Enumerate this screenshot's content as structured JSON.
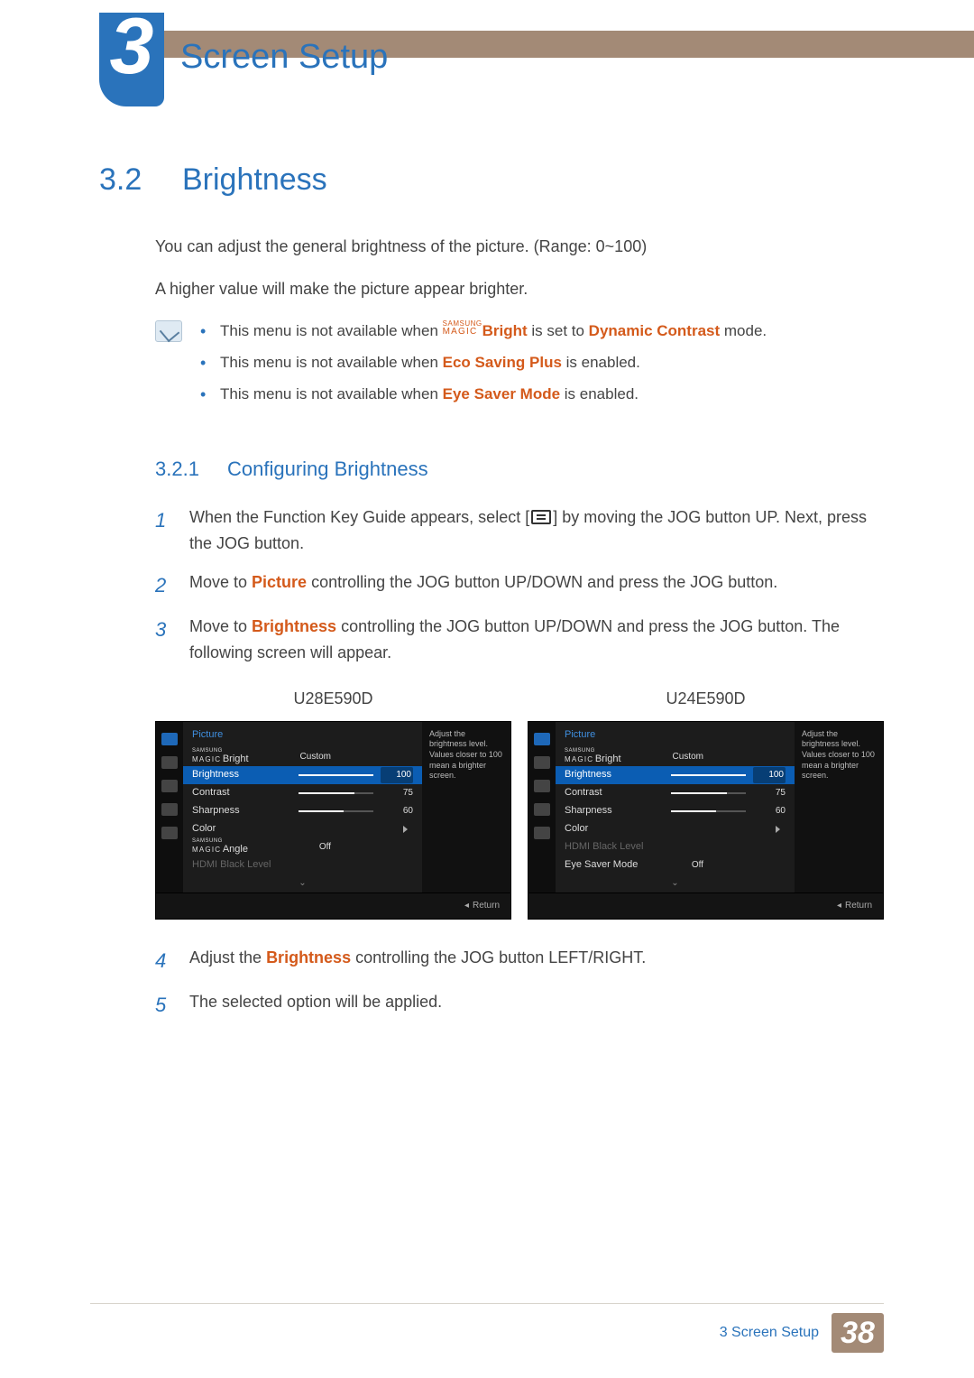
{
  "chapter": {
    "number": "3",
    "title": "Screen Setup"
  },
  "section": {
    "number": "3.2",
    "title": "Brightness"
  },
  "intro": {
    "p1": "You can adjust the general brightness of the picture. (Range: 0~100)",
    "p2": "A higher value will make the picture appear brighter."
  },
  "notes": {
    "items": [
      {
        "pre": "This menu is not available when ",
        "magic": true,
        "bold": "Bright",
        "mid": " is set to ",
        "red": "Dynamic Contrast",
        "post": " mode."
      },
      {
        "pre": "This menu is not available when ",
        "magic": false,
        "bold": "",
        "mid": "",
        "red": "Eco Saving Plus",
        "post": " is enabled."
      },
      {
        "pre": "This menu is not available when ",
        "magic": false,
        "bold": "",
        "mid": "",
        "red": "Eye Saver Mode",
        "post": " is enabled."
      }
    ]
  },
  "subsection": {
    "number": "3.2.1",
    "title": "Configuring Brightness"
  },
  "steps": [
    {
      "n": "1",
      "pre": "When the Function Key Guide appears, select [",
      "post": "] by moving the JOG button UP. Next, press the JOG button.",
      "symbol": true
    },
    {
      "n": "2",
      "pre": "Move to ",
      "red": "Picture",
      "post": " controlling the JOG button UP/DOWN and press the JOG button."
    },
    {
      "n": "3",
      "pre": "Move to ",
      "red": "Brightness",
      "post": " controlling the JOG button UP/DOWN and press the JOG button. The following screen will appear."
    },
    {
      "n": "4",
      "pre": "Adjust the ",
      "red": "Brightness",
      "post": " controlling the JOG button LEFT/RIGHT."
    },
    {
      "n": "5",
      "pre": "The selected option will be applied.",
      "red": "",
      "post": ""
    }
  ],
  "osd": {
    "help_text": "Adjust the brightness level. Values closer to 100 mean a brighter screen.",
    "return_label": "Return",
    "models": [
      {
        "model": "U28E590D",
        "header": "Picture",
        "rows": [
          {
            "type": "magic",
            "suffix": "Bright",
            "value": "Custom"
          },
          {
            "type": "slider",
            "label": "Brightness",
            "value": "100",
            "fill": 100,
            "selected": true
          },
          {
            "type": "slider",
            "label": "Contrast",
            "value": "75",
            "fill": 75
          },
          {
            "type": "slider",
            "label": "Sharpness",
            "value": "60",
            "fill": 60
          },
          {
            "type": "submenu",
            "label": "Color"
          },
          {
            "type": "magic",
            "suffix": "Angle",
            "value": "Off"
          },
          {
            "type": "dim",
            "label": "HDMI Black Level"
          },
          {
            "type": "chev"
          }
        ]
      },
      {
        "model": "U24E590D",
        "header": "Picture",
        "rows": [
          {
            "type": "magic",
            "suffix": "Bright",
            "value": "Custom"
          },
          {
            "type": "slider",
            "label": "Brightness",
            "value": "100",
            "fill": 100,
            "selected": true
          },
          {
            "type": "slider",
            "label": "Contrast",
            "value": "75",
            "fill": 75
          },
          {
            "type": "slider",
            "label": "Sharpness",
            "value": "60",
            "fill": 60
          },
          {
            "type": "submenu",
            "label": "Color"
          },
          {
            "type": "dim",
            "label": "HDMI Black Level"
          },
          {
            "type": "value",
            "label": "Eye Saver Mode",
            "value": "Off"
          },
          {
            "type": "chev"
          }
        ]
      }
    ]
  },
  "footer": {
    "text": "3 Screen Setup",
    "page": "38"
  },
  "magic_brand": {
    "line1": "SAMSUNG",
    "line2": "MAGIC"
  }
}
